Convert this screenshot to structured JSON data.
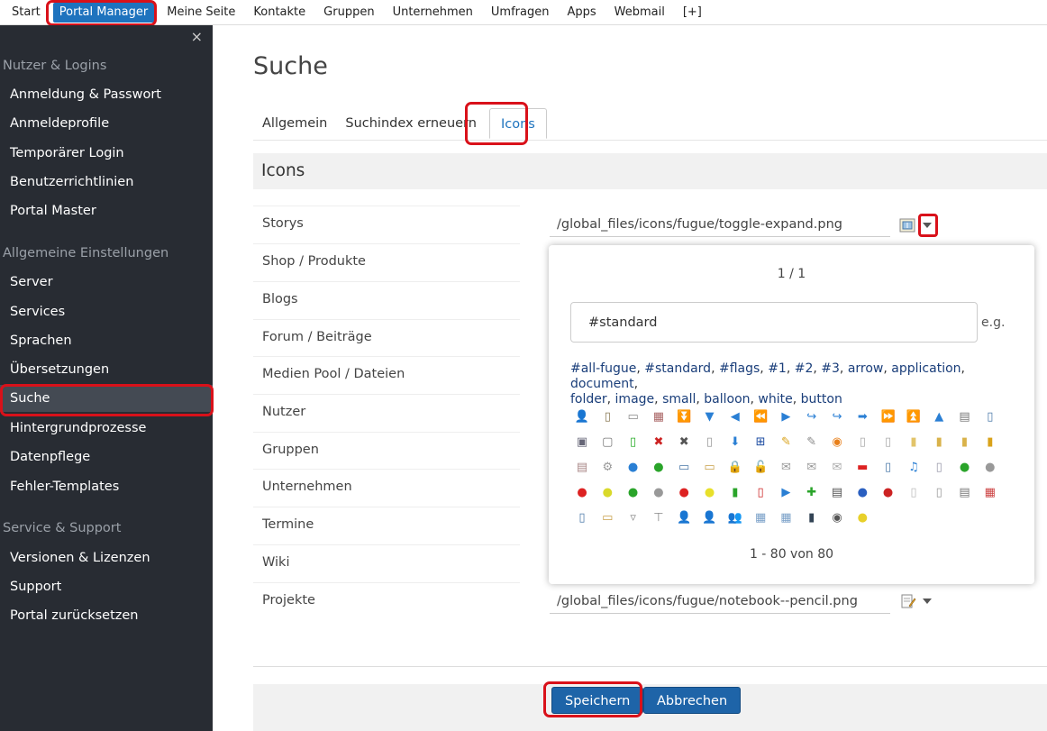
{
  "topnav": {
    "items": [
      "Start",
      "Portal Manager",
      "Meine Seite",
      "Kontakte",
      "Gruppen",
      "Unternehmen",
      "Umfragen",
      "Apps",
      "Webmail",
      "[+]"
    ],
    "active_index": 1
  },
  "sidebar": {
    "close": "×",
    "groups": [
      {
        "title": "Nutzer & Logins",
        "items": [
          "Anmeldung & Passwort",
          "Anmeldeprofile",
          "Temporärer Login",
          "Benutzerrichtlinien",
          "Portal Master"
        ]
      },
      {
        "title": "Allgemeine Einstellungen",
        "items": [
          "Server",
          "Services",
          "Sprachen",
          "Übersetzungen",
          "Suche",
          "Hintergrundprozesse",
          "Datenpflege",
          "Fehler-Templates"
        ]
      },
      {
        "title": "Service & Support",
        "items": [
          "Versionen & Lizenzen",
          "Support",
          "Portal zurücksetzen"
        ]
      }
    ],
    "active_item": "Suche"
  },
  "page": {
    "title": "Suche",
    "tabs": [
      "Allgemein",
      "Suchindex erneuern",
      "Icons"
    ],
    "active_tab": "Icons",
    "section_title": "Icons"
  },
  "rows": [
    "Storys",
    "Shop / Produkte",
    "Blogs",
    "Forum / Beiträge",
    "Medien Pool / Dateien",
    "Nutzer",
    "Gruppen",
    "Unternehmen",
    "Termine",
    "Wiki",
    "Projekte"
  ],
  "fields": {
    "storys_path": "/global_files/icons/fugue/toggle-expand.png",
    "projekte_path": "/global_files/icons/fugue/notebook--pencil.png"
  },
  "popup": {
    "pager_top": "1 / 1",
    "search_value": "#standard",
    "eg_label": "e.g.",
    "tags": [
      "#all-fugue",
      "#standard",
      "#flags",
      "#1",
      "#2",
      "#3",
      "arrow",
      "application",
      "document",
      "folder",
      "image",
      "small",
      "balloon",
      "white",
      "button"
    ],
    "pager_bottom": "1 - 80 von 80"
  },
  "buttons": {
    "save": "Speichern",
    "cancel": "Abbrechen"
  },
  "colors": {
    "accent": "#1e73be",
    "sidebar_bg": "#282c33",
    "highlight": "#d9111a"
  }
}
